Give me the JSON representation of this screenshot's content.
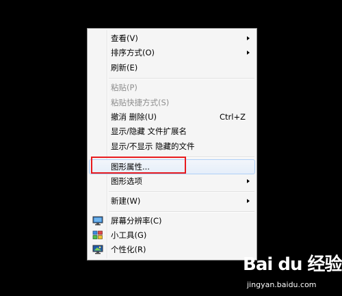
{
  "menu": {
    "items": [
      {
        "label": "查看(V)"
      },
      {
        "label": "排序方式(O)"
      },
      {
        "label": "刷新(E)"
      },
      {
        "label": "粘贴(P)"
      },
      {
        "label": "粘贴快捷方式(S)"
      },
      {
        "label": "撤消 删除(U)",
        "shortcut": "Ctrl+Z"
      },
      {
        "label": "显示/隐藏 文件扩展名"
      },
      {
        "label": "显示/不显示 隐藏的文件"
      },
      {
        "label": "图形属性..."
      },
      {
        "label": "图形选项"
      },
      {
        "label": "新建(W)"
      },
      {
        "label": "屏幕分辨率(C)",
        "icon": "monitor-resolution-icon"
      },
      {
        "label": "小工具(G)",
        "icon": "gadgets-icon"
      },
      {
        "label": "个性化(R)",
        "icon": "personalize-icon"
      }
    ]
  },
  "colors": {
    "background": "#000000",
    "menu_bg": "#f5f5f5",
    "disabled_text": "#8d8d8d",
    "annotation_red": "#e8191c",
    "hover_border": "#aecff7"
  },
  "watermark": {
    "logo_text": "Bai du 经验",
    "url": "jingyan.baidu.com"
  }
}
